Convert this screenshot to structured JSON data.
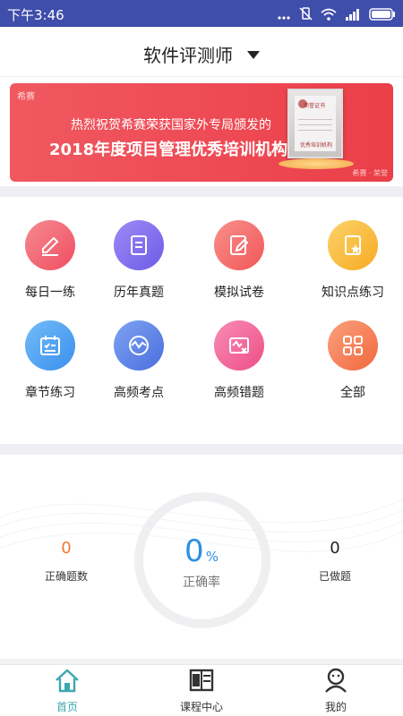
{
  "status_bar": {
    "time": "下午3:46",
    "icons": [
      "more-dots-icon",
      "vibrate-off-icon",
      "wifi-icon",
      "signal-icon",
      "battery-icon"
    ]
  },
  "header": {
    "title": "软件评测师",
    "dropdown_icon": "caret-down-icon"
  },
  "banner": {
    "brand": "希赛",
    "line1": "热烈祝贺希赛荣获国家外专局颁发的",
    "line2": "2018年度项目管理优秀培训机构",
    "plaque_title": "荣誉证书",
    "plaque_caption": "优秀培训机构",
    "corner_text": "希赛 · 荣誉",
    "background": "#ef4b55"
  },
  "grid": {
    "items": [
      {
        "label": "每日一练",
        "icon": "pencil-icon",
        "color": "#f3626f"
      },
      {
        "label": "历年真题",
        "icon": "clipboard-icon",
        "color": "#7f6ef0"
      },
      {
        "label": "模拟试卷",
        "icon": "edit-paper-icon",
        "color": "#f5706b"
      },
      {
        "label": "知识点练习",
        "icon": "star-document-icon",
        "color": "#f8bd3c"
      },
      {
        "label": "章节练习",
        "icon": "calendar-list-icon",
        "color": "#4a9ff0"
      },
      {
        "label": "高频考点",
        "icon": "wave-check-icon",
        "color": "#5a83e6"
      },
      {
        "label": "高频错题",
        "icon": "error-card-icon",
        "color": "#f2679a"
      },
      {
        "label": "全部",
        "icon": "grid-apps-icon",
        "color": "#f77b50"
      }
    ]
  },
  "stats": {
    "correct_count": "0",
    "correct_label": "正确题数",
    "accuracy_value": "0",
    "accuracy_sign": "%",
    "accuracy_label": "正确率",
    "done_count": "0",
    "done_label": "已做题",
    "correct_color": "#f07830",
    "accuracy_color": "#2d8ee6"
  },
  "tabbar": {
    "tabs": [
      {
        "label": "首页",
        "icon": "home-icon",
        "active": true
      },
      {
        "label": "课程中心",
        "icon": "course-book-icon",
        "active": false
      },
      {
        "label": "我的",
        "icon": "user-icon",
        "active": false
      }
    ],
    "active_color": "#3ba7b0"
  }
}
